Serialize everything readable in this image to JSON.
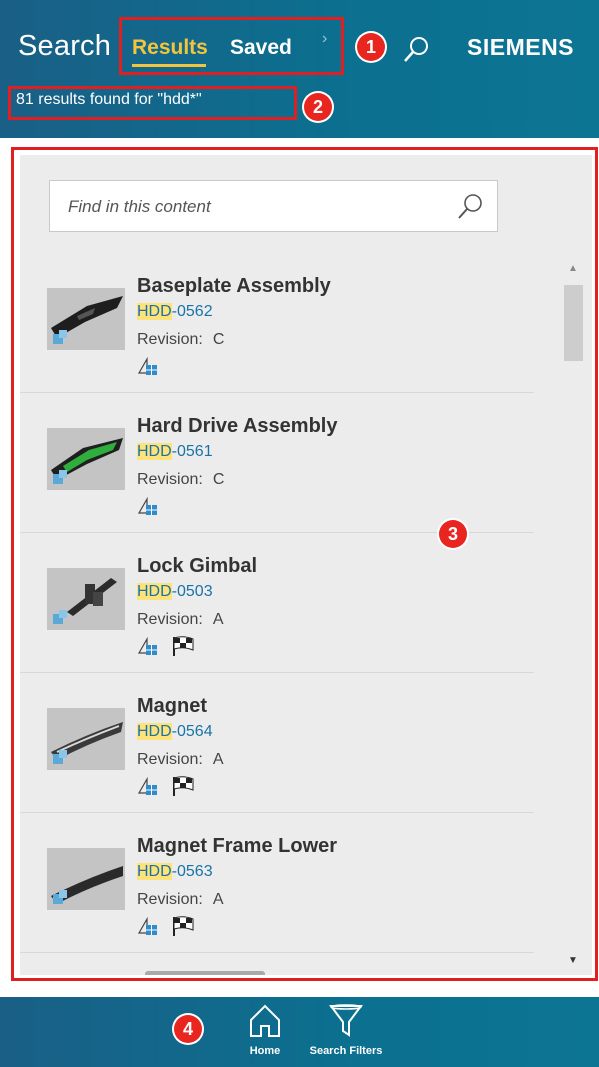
{
  "header": {
    "title": "Search",
    "tabs": [
      {
        "label": "Results",
        "active": true
      },
      {
        "label": "Saved",
        "active": false
      }
    ],
    "chevron": "›",
    "search_icon": "search-icon",
    "brand": "SIEMENS",
    "result_count": "81 results found for \"hdd*\""
  },
  "find": {
    "placeholder": "Find in this content"
  },
  "items": [
    {
      "name": "Baseplate Assembly",
      "id_highlight": "HDD",
      "id_rest": "-0562",
      "revision_label": "Revision:",
      "revision": "C",
      "icons": [
        "assembly-icon"
      ]
    },
    {
      "name": "Hard Drive Assembly",
      "id_highlight": "HDD",
      "id_rest": "-0561",
      "revision_label": "Revision:",
      "revision": "C",
      "icons": [
        "assembly-icon"
      ]
    },
    {
      "name": "Lock Gimbal",
      "id_highlight": "HDD",
      "id_rest": "-0503",
      "revision_label": "Revision:",
      "revision": "A",
      "icons": [
        "assembly-icon",
        "checkered-flag-icon"
      ]
    },
    {
      "name": "Magnet",
      "id_highlight": "HDD",
      "id_rest": "-0564",
      "revision_label": "Revision:",
      "revision": "A",
      "icons": [
        "assembly-icon",
        "checkered-flag-icon"
      ]
    },
    {
      "name": "Magnet Frame Lower",
      "id_highlight": "HDD",
      "id_rest": "-0563",
      "revision_label": "Revision:",
      "revision": "A",
      "icons": [
        "assembly-icon",
        "checkered-flag-icon"
      ]
    }
  ],
  "bottom_nav": [
    {
      "label": "Home",
      "icon": "home-icon"
    },
    {
      "label": "Search Filters",
      "icon": "filter-icon"
    }
  ],
  "annotations": [
    "1",
    "2",
    "3",
    "4"
  ],
  "colors": {
    "header": "#0c6f8f",
    "accent_tab": "#f3c53c",
    "badge": "#e8251e",
    "highlight": "#ffe27a",
    "link": "#1a73a8"
  }
}
